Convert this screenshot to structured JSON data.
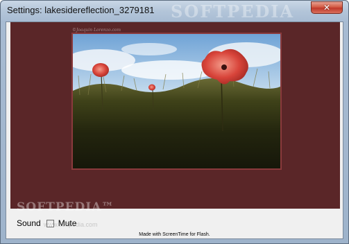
{
  "window": {
    "title": "Settings: lakesidereflection_3279181",
    "watermark": "SOFTPEDIA",
    "close_glyph": "✕"
  },
  "stage": {
    "background_color": "#5a2628",
    "credit": "©Joaquin Lorenzo.com",
    "watermark": "SOFTPEDIA™",
    "ghost_url": "www.softpedia.com"
  },
  "controls": {
    "sound_label": "Sound",
    "mute_label": "Mute",
    "mute_checked": false
  },
  "footer": {
    "text": "Made with ScreenTime for Flash."
  },
  "icons": {
    "close": "close-icon",
    "checkbox": "checkbox-icon"
  }
}
